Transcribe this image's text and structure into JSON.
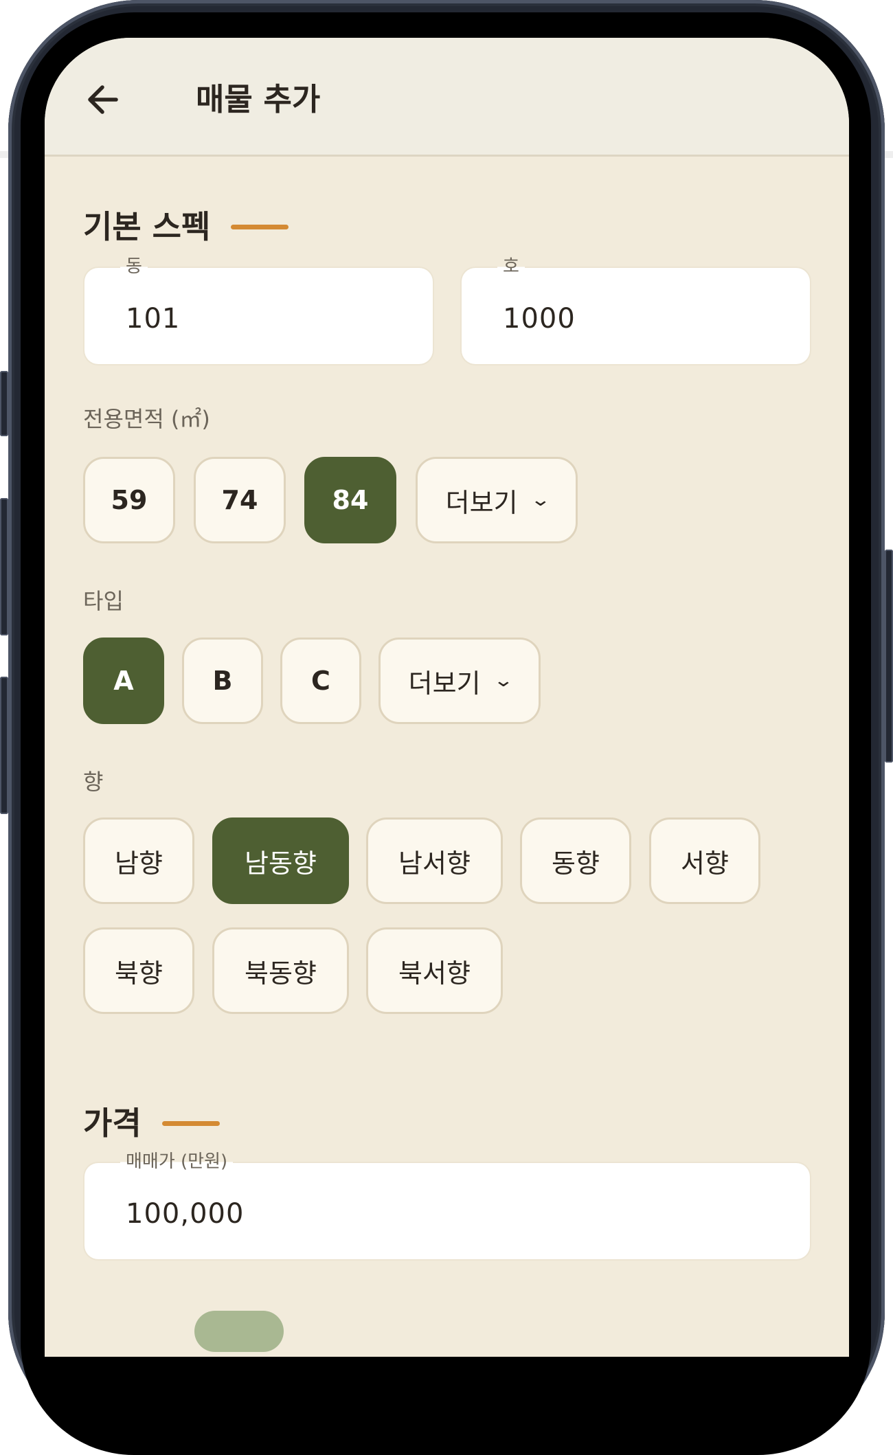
{
  "app_bar": {
    "back_icon": "arrow-left-icon",
    "title": "매물 추가"
  },
  "basic_spec": {
    "title": "기본 스펙",
    "dong": {
      "label": "동",
      "value": "101"
    },
    "ho": {
      "label": "호",
      "value": "1000"
    },
    "area": {
      "label": "전용면적 (㎡)",
      "options": [
        "59",
        "74",
        "84"
      ],
      "selected": "84",
      "more_label": "더보기"
    },
    "type": {
      "label": "타입",
      "options": [
        "A",
        "B",
        "C"
      ],
      "selected": "A",
      "more_label": "더보기"
    },
    "direction": {
      "label": "향",
      "options": [
        "남향",
        "남동향",
        "남서향",
        "동향",
        "서향",
        "북향",
        "북동향",
        "북서향"
      ],
      "selected": "남동향"
    }
  },
  "price": {
    "title": "가격",
    "sale_price": {
      "label": "매매가 (만원)",
      "value": "100,000"
    }
  },
  "colors": {
    "accent": "#d48a33",
    "selected_chip": "#4e5f32",
    "background": "#f2ebdb"
  }
}
